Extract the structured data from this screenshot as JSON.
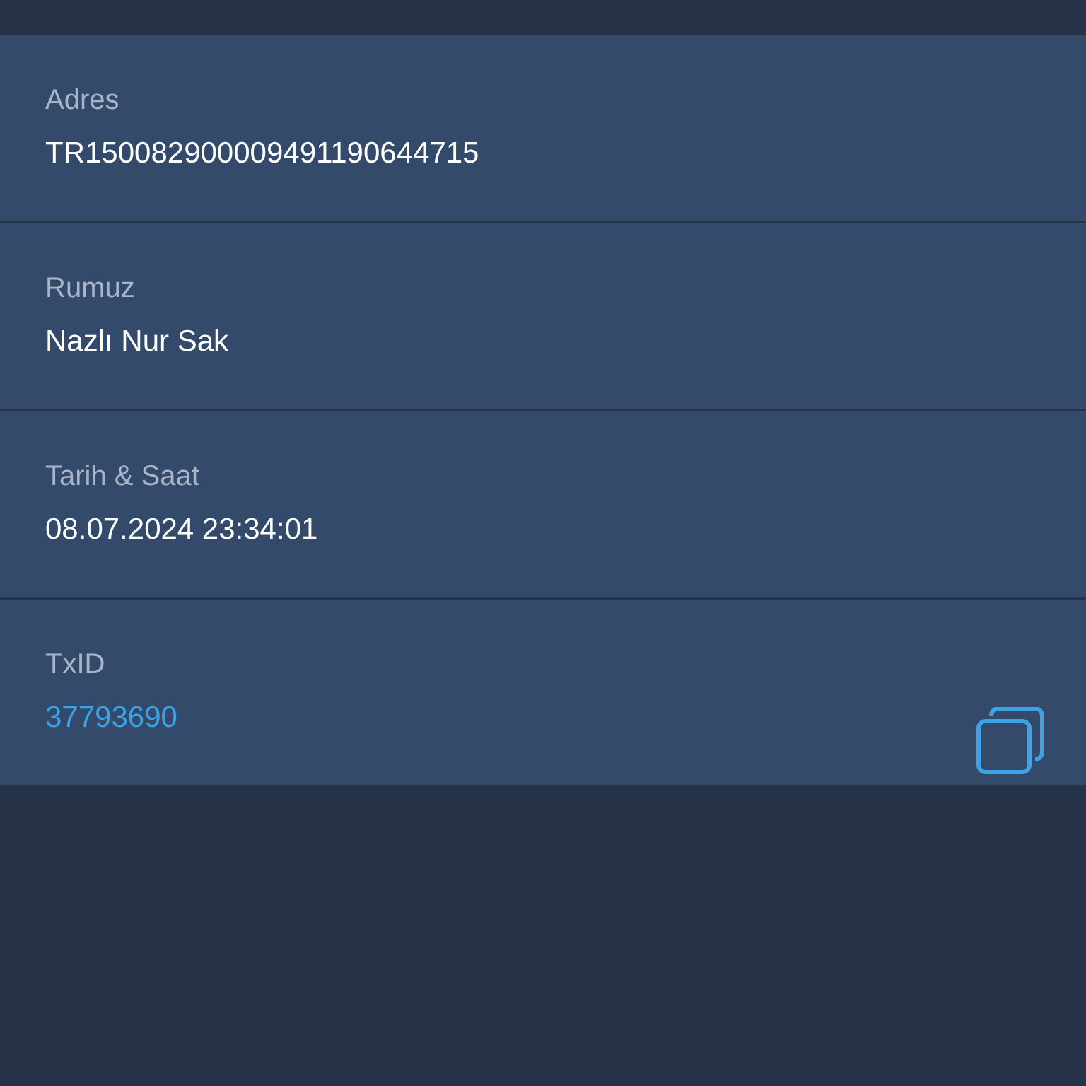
{
  "fields": [
    {
      "label": "Adres",
      "value": "TR150082900009491190644715",
      "kind": "text",
      "copyable": false
    },
    {
      "label": "Rumuz",
      "value": "Nazlı Nur Sak",
      "kind": "text",
      "copyable": false
    },
    {
      "label": "Tarih & Saat",
      "value": "08.07.2024 23:34:01",
      "kind": "text",
      "copyable": false
    },
    {
      "label": "TxID",
      "value": "37793690",
      "kind": "link",
      "copyable": true
    }
  ]
}
